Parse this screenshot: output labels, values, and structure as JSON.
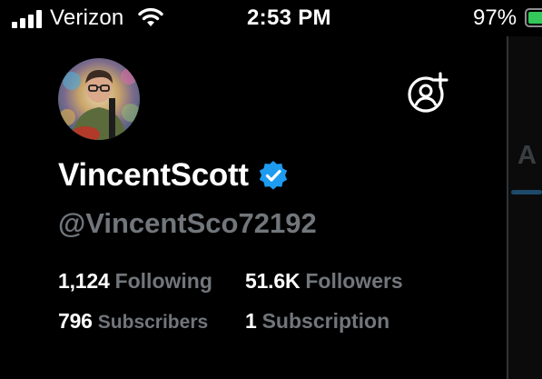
{
  "status_bar": {
    "carrier": "Verizon",
    "time": "2:53 PM",
    "battery_percent": "97%",
    "battery_level": 0.97,
    "icons": [
      "signal-icon",
      "wifi-icon",
      "battery-icon"
    ]
  },
  "profile": {
    "display_name": "VincentScott",
    "handle": "@VincentSco72192",
    "verified": true,
    "verified_color": "#1d9bf0",
    "stats": [
      {
        "number": "1,124",
        "label": "Following"
      },
      {
        "number": "51.6K",
        "label": "Followers"
      },
      {
        "number": "796",
        "label": "Subscribers"
      },
      {
        "number": "1",
        "label": "Subscription"
      }
    ]
  },
  "side_panel": {
    "tab_letter": "A"
  },
  "colors": {
    "background": "#000000",
    "primary_text": "#ffffff",
    "secondary_text": "#71767b",
    "accent": "#1d9bf0"
  }
}
